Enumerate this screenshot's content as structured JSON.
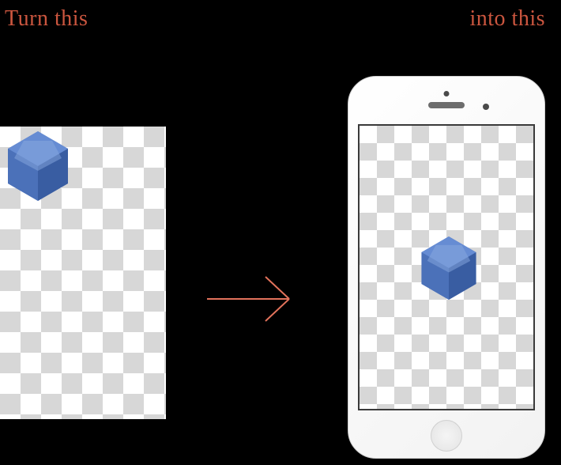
{
  "titles": {
    "left": "Turn this",
    "right": "into this"
  },
  "colors": {
    "accent_text": "#cb563f",
    "arrow": "#e2725b",
    "hex_light": "#6a8fd6",
    "hex_mid": "#5177c0",
    "hex_dark": "#365a9e"
  },
  "diagram": {
    "arrow_direction": "right",
    "left_panel": {
      "hex_position": "top-left"
    },
    "right_panel": {
      "device": "smartphone",
      "hex_position": "center"
    }
  }
}
